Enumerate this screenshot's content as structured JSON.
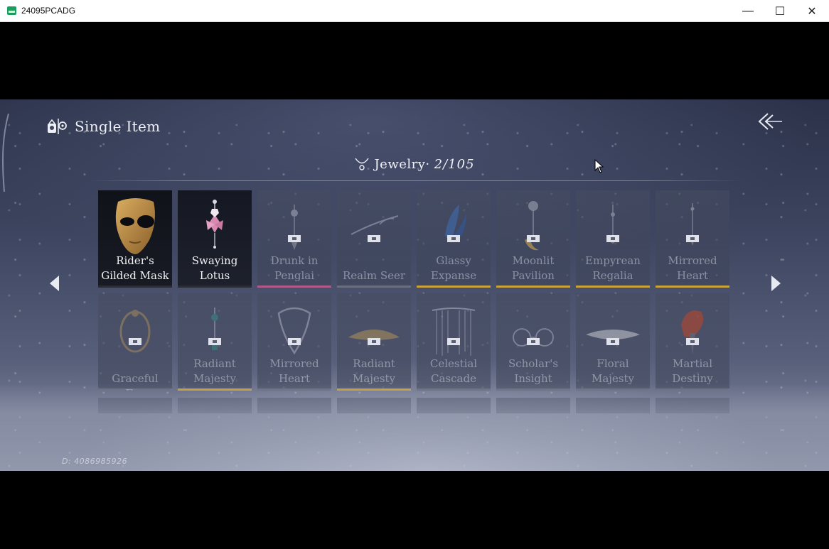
{
  "window": {
    "title": "24095PCADG",
    "minimize_glyph": "—",
    "maximize_glyph": "☐",
    "close_glyph": "✕"
  },
  "header": {
    "title": "Single Item",
    "icon": "outfit-icon"
  },
  "category": {
    "icon": "necklace-icon",
    "label": "Jewelry·",
    "count": "2/105"
  },
  "items_row1": [
    {
      "name": "Rider's\nGilded Mask",
      "owned": true,
      "accent": "#2a2d36"
    },
    {
      "name": "Swaying\nLotus",
      "owned": true,
      "accent": "#2a2d36"
    },
    {
      "name": "Drunk in\nPenglai",
      "owned": false,
      "accent": "#b05a8c"
    },
    {
      "name": "Realm Seer",
      "owned": false,
      "accent": "#6a6f80"
    },
    {
      "name": "Glassy\nExpanse",
      "owned": false,
      "accent": "#c8a23c"
    },
    {
      "name": "Moonlit\nPavilion",
      "owned": false,
      "accent": "#c8a23c"
    },
    {
      "name": "Empyrean\nRegalia",
      "owned": false,
      "accent": "#c8a23c"
    },
    {
      "name": "Mirrored\nHeart",
      "owned": false,
      "accent": "#c8a23c"
    }
  ],
  "items_row2": [
    {
      "name": "Graceful Fox",
      "owned": false,
      "accent": "#6a6f80"
    },
    {
      "name": "Radiant\nMajesty",
      "owned": false,
      "accent": "#c8a23c"
    },
    {
      "name": "Mirrored\nHeart",
      "owned": false,
      "accent": "#6a6f80"
    },
    {
      "name": "Radiant\nMajesty",
      "owned": false,
      "accent": "#c8a23c"
    },
    {
      "name": "Celestial\nCascade",
      "owned": false,
      "accent": "#6a6f80"
    },
    {
      "name": "Scholar's\nInsight",
      "owned": false,
      "accent": "#6a6f80"
    },
    {
      "name": "Floral\nMajesty",
      "owned": false,
      "accent": "#6a6f80"
    },
    {
      "name": "Martial\nDestiny",
      "owned": false,
      "accent": "#6a6f80"
    }
  ],
  "uid": "D: 4086985926"
}
